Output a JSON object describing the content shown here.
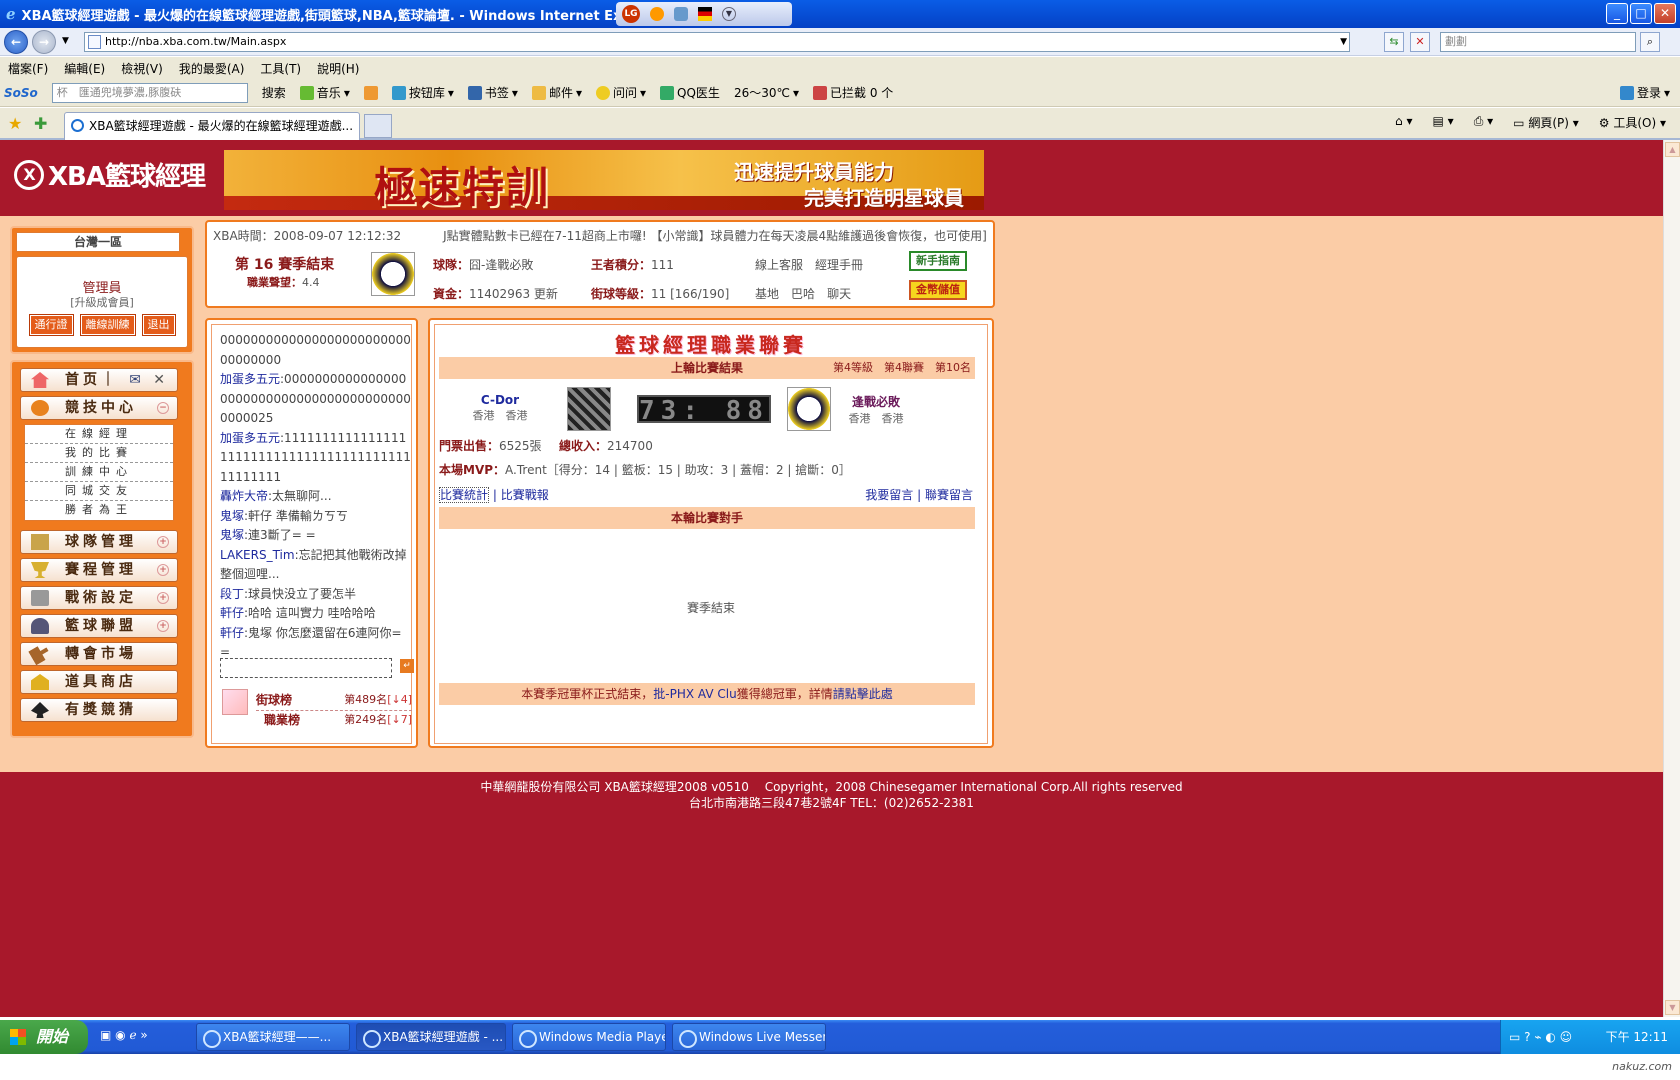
{
  "window": {
    "title": "XBA籃球經理遊戲 - 最火爆的在線籃球經理遊戲,街頭籃球,NBA,籃球論壇. - Windows Internet Explorer",
    "lg": "LG"
  },
  "address": {
    "url": "http://nba.xba.com.tw/Main.aspx",
    "search_placeholder": "劃劃"
  },
  "menu": [
    "檔案(F)",
    "編輯(E)",
    "檢視(V)",
    "我的最愛(A)",
    "工具(T)",
    "說明(H)"
  ],
  "toolbar": {
    "soso": "SoSo",
    "search_text": "杯　匯通兜境夢濃,豚腹砆",
    "search": "搜索",
    "music": "音乐",
    "btnlib": "按钮库",
    "bookmark": "书签",
    "mail": "邮件",
    "ask": "问问",
    "qq": "QQ医生",
    "weather": "26～30℃",
    "blocked": "已拦截 0 个",
    "login": "登录"
  },
  "tab": {
    "title": "XBA籃球經理遊戲 - 最火爆的在線籃球經理遊戲..."
  },
  "rtools": {
    "page": "網頁(P)",
    "tools": "工具(O)"
  },
  "site": {
    "logo": "XBA籃球經理",
    "banner": {
      "big": "極速特訓",
      "line1": "迅速提升球員能力",
      "line2": "完美打造明星球員"
    },
    "region": "台灣一區",
    "user": {
      "role": "管理員",
      "upgrade": "[升級成會員]",
      "btn1": "通行證",
      "btn2": "離線訓練",
      "btn3": "退出"
    },
    "nav": {
      "home": "首页",
      "arena": "競技中心",
      "team": "球隊管理",
      "schedule": "賽程管理",
      "tactics": "戰術設定",
      "alliance": "籃球聯盟",
      "transfer": "轉會市場",
      "shop": "道具商店",
      "lottery": "有獎競猜"
    },
    "submenu": [
      "在線經理",
      "我的比賽",
      "訓練中心",
      "同城交友",
      "勝者為王"
    ],
    "info": {
      "time": "XBA時間：2008-09-07 12:12:32",
      "ticker": "J點實體點數卡已經在7-11超商上市囉! 【小常識】球員體力在每天凌晨4點維護過後會恢復，也可使用]",
      "season": "第 16 賽季結束",
      "rep_label": "職業聲望：",
      "rep": "4.4",
      "team_label": "球隊：",
      "team": "囧-逢戰必敗",
      "king_label": "王者積分：",
      "king": "111",
      "online": "線上客服",
      "manual": "經理手冊",
      "guide": "新手指南",
      "fund_label": "資金：",
      "fund": "11402963",
      "update": "更新",
      "level_label": "街球等級：",
      "level": "11 [166/190]",
      "base": "基地",
      "bar": "巴哈",
      "chat": "聊天",
      "deposit": "金幣儲值"
    },
    "chat": [
      {
        "u": "",
        "t": "000000000000000000000000000000000"
      },
      {
        "u": "加蛋多五元",
        "t": ":000000000000000000000000000000000000000000000025"
      },
      {
        "u": "加蛋多五元",
        "t": ":1111111111111111111111111111111111111111111111111"
      },
      {
        "u": "轟炸大帝",
        "t": ":太無聊阿..."
      },
      {
        "u": "鬼塚",
        "t": ":軒仔 準備輸ㄌㄎㄎ"
      },
      {
        "u": "鬼塚",
        "t": ":連3斷了= ="
      },
      {
        "u": "LAKERS_Tim",
        "t": ":忘記把其他戰術改掉整個迴哩..."
      },
      {
        "u": "段丁",
        "t": ":球員快没立了要怎半"
      },
      {
        "u": "軒仔",
        "t": ":哈哈 這叫實力 哇哈哈哈"
      },
      {
        "u": "軒仔",
        "t": ":鬼塚 你怎麼還留在6連阿你= ="
      }
    ],
    "rank": {
      "street": "街球榜",
      "street_rank": "第489名",
      "street_delta": "[↓4]",
      "pro": "職業榜",
      "pro_rank": "第249名",
      "pro_delta": "[↓7]"
    },
    "league": {
      "title": "籃球經理職業聯賽",
      "last_result": "上輪比賽結果",
      "division": "第4等級　第4聯賽　第10名",
      "home_team": "C-Dor",
      "home_loc": "香港　香港",
      "score": "73: 88",
      "away_team": "逢戰必敗",
      "away_loc": "香港　香港",
      "tickets_label": "門票出售：",
      "tickets": "6525張",
      "income_label": "總收入：",
      "income": "214700",
      "mvp_label": "本場MVP：",
      "mvp": "A.Trent［得分：14 | 籃板：15 | 助攻：3 | 蓋帽：2 | 搶斷：0］",
      "stats": "比賽統計",
      "report": "比賽戰報",
      "msg": "我要留言",
      "league_msg": "聯賽留言",
      "opponent": "本輪比賽對手",
      "season_end": "賽季結束",
      "cup_pre": "本賽季冠軍杯正式結束，",
      "cup_team": "批-PHX AV Clu",
      "cup_mid": "獲得總冠軍，詳情",
      "cup_link": "請點擊此處"
    },
    "footer1": "中華網龍股份有限公司 XBA籃球經理2008 v0510　 Copyright，2008 Chinesegamer International Corp.All rights reserved",
    "footer2": "台北市南港路三段47巷2號4F TEL：(02)2652-2381"
  },
  "taskbar": {
    "start": "開始",
    "t1": "XBA籃球經理——...",
    "t2": "XBA籃球經理遊戲 - ...",
    "t3": "Windows Media Player",
    "t4": "Windows Live Messen...",
    "clock": "下午 12:11"
  },
  "watermark": "nakuz.com"
}
